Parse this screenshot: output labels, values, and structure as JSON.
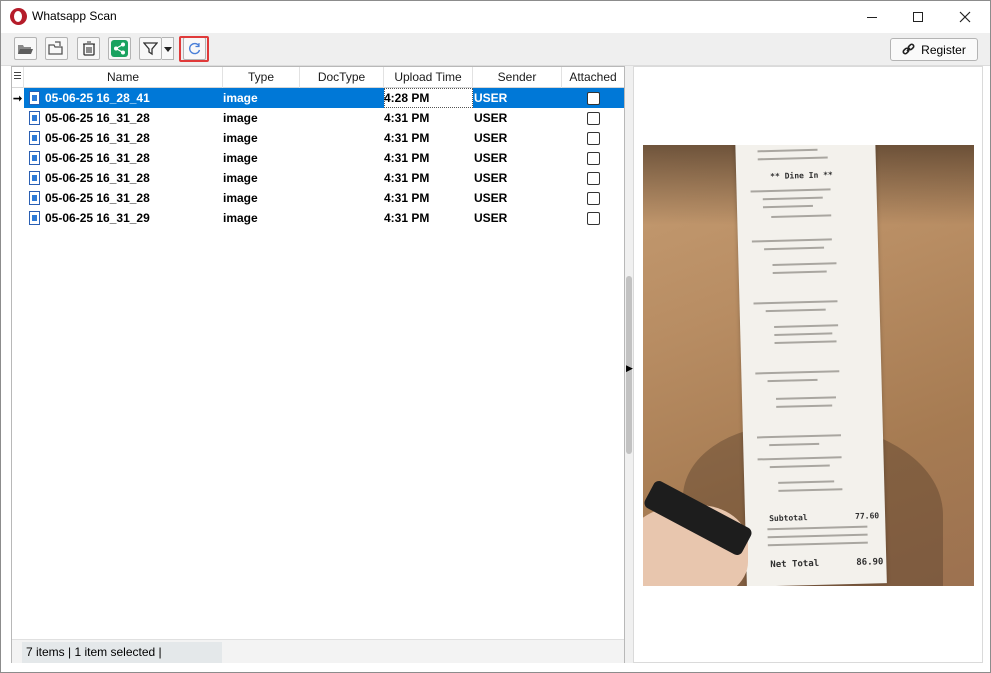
{
  "window": {
    "title": "Whatsapp Scan",
    "icon": "app-logo-icon"
  },
  "toolbar": {
    "buttons": [
      "open-folder-icon",
      "open-file-icon",
      "delete-icon",
      "share-icon",
      "filter-icon",
      "refresh-icon"
    ],
    "register_label": "Register"
  },
  "grid": {
    "columns": [
      "Name",
      "Type",
      "DocType",
      "Upload Time",
      "Sender",
      "Attached"
    ],
    "rows": [
      {
        "name": "05-06-25 16_28_41",
        "type": "image",
        "doctype": "",
        "upload_time": "4:28 PM",
        "sender": "USER",
        "attached": false,
        "selected": true
      },
      {
        "name": "05-06-25 16_31_28",
        "type": "image",
        "doctype": "",
        "upload_time": "4:31 PM",
        "sender": "USER",
        "attached": false,
        "selected": false
      },
      {
        "name": "05-06-25 16_31_28",
        "type": "image",
        "doctype": "",
        "upload_time": "4:31 PM",
        "sender": "USER",
        "attached": false,
        "selected": false
      },
      {
        "name": "05-06-25 16_31_28",
        "type": "image",
        "doctype": "",
        "upload_time": "4:31 PM",
        "sender": "USER",
        "attached": false,
        "selected": false
      },
      {
        "name": "05-06-25 16_31_28",
        "type": "image",
        "doctype": "",
        "upload_time": "4:31 PM",
        "sender": "USER",
        "attached": false,
        "selected": false
      },
      {
        "name": "05-06-25 16_31_28",
        "type": "image",
        "doctype": "",
        "upload_time": "4:31 PM",
        "sender": "USER",
        "attached": false,
        "selected": false
      },
      {
        "name": "05-06-25 16_31_29",
        "type": "image",
        "doctype": "",
        "upload_time": "4:31 PM",
        "sender": "USER",
        "attached": false,
        "selected": false
      }
    ]
  },
  "status": {
    "text": "7 items |  1 item selected |"
  },
  "preview": {
    "receipt_lines": [
      "** Dine In **",
      "Subtotal",
      "77.60",
      "Net Total",
      "86.90"
    ]
  },
  "colors": {
    "selection": "#0078d7",
    "highlight": "#e03a3a",
    "share_green": "#1aa260"
  }
}
